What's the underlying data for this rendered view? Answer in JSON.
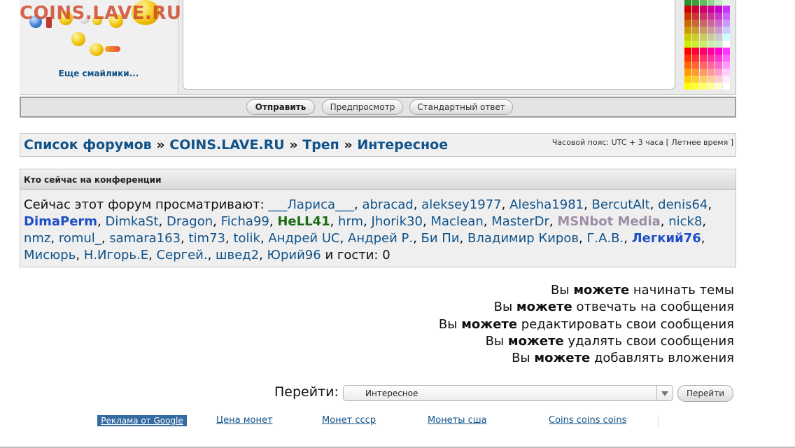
{
  "watermark": "COINS.LAVE.RU",
  "smileys": {
    "more_link": "Еще смайлики..."
  },
  "palette": {
    "colors": [
      [
        "#2e8b2e",
        "#3aa13a",
        "#5cbf5c",
        "#8fd68f",
        "#c2eec2",
        "#e6f9e6"
      ],
      [
        "#cc0000",
        "#cc0033",
        "#cc0066",
        "#cc0099",
        "#cc00cc",
        "#cc33ff"
      ],
      [
        "#cc3300",
        "#cc3333",
        "#cc3366",
        "#cc3399",
        "#cc33cc",
        "#cc66ff"
      ],
      [
        "#cc6600",
        "#cc6633",
        "#cc6666",
        "#cc6699",
        "#cc66cc",
        "#cc99ff"
      ],
      [
        "#cc9900",
        "#cc9933",
        "#cc9966",
        "#cc9999",
        "#cc99cc",
        "#ccccff"
      ],
      [
        "#cccc00",
        "#cccc33",
        "#cccc66",
        "#cccc99",
        "#cccccc",
        "#ccffff"
      ],
      [
        "#ccee00",
        "#ccee33",
        "#ccee66",
        "#cceeaa",
        "#cceecc",
        "#ffffff"
      ],
      [
        "#ff0000",
        "#ff0033",
        "#ff0066",
        "#ff0099",
        "#ff00cc",
        "#ff33ff"
      ],
      [
        "#ff3300",
        "#ff3333",
        "#ff3366",
        "#ff3399",
        "#ff33cc",
        "#ff66ff"
      ],
      [
        "#ff6600",
        "#ff6633",
        "#ff6666",
        "#ff6699",
        "#ff66cc",
        "#ff99ff"
      ],
      [
        "#ff9900",
        "#ff9933",
        "#ff9966",
        "#ff9999",
        "#ff99cc",
        "#ffccff"
      ],
      [
        "#ffcc00",
        "#ffcc33",
        "#ffcc66",
        "#ffcc99",
        "#ffcccc",
        "#ffeeff"
      ],
      [
        "#ffff00",
        "#ffff33",
        "#ffff66",
        "#ffff99",
        "#ffffcc",
        "#ffffff"
      ]
    ]
  },
  "buttons": {
    "submit": "Отправить",
    "preview": "Предпросмотр",
    "standard": "Стандартный ответ"
  },
  "breadcrumb": {
    "items": [
      "Список форумов",
      "COINS.LAVE.RU",
      "Треп",
      "Интересное"
    ],
    "separator": "»"
  },
  "timezone": "Часовой пояс: UTC + 3 часа [ Летнее время ]",
  "online": {
    "title": "Кто сейчас на конференции",
    "prefix": "Сейчас этот форум просматривают:",
    "users": [
      {
        "name": "___Лариса___",
        "type": "user"
      },
      {
        "name": "abracad",
        "type": "user"
      },
      {
        "name": "aleksey1977",
        "type": "user"
      },
      {
        "name": "Alesha1981",
        "type": "user"
      },
      {
        "name": "BercutAlt",
        "type": "user"
      },
      {
        "name": "denis64",
        "type": "user"
      },
      {
        "name": "DimaPerm",
        "type": "mod"
      },
      {
        "name": "DimkaSt",
        "type": "user"
      },
      {
        "name": "Dragon",
        "type": "user"
      },
      {
        "name": "Ficha99",
        "type": "user"
      },
      {
        "name": "HeLL41",
        "type": "adm"
      },
      {
        "name": "hrm",
        "type": "user"
      },
      {
        "name": "Jhorik30",
        "type": "user"
      },
      {
        "name": "MacIean",
        "type": "user"
      },
      {
        "name": "MasterDr",
        "type": "user"
      },
      {
        "name": "MSNbot Media",
        "type": "bot"
      },
      {
        "name": "nick8",
        "type": "user"
      },
      {
        "name": "nmz",
        "type": "user"
      },
      {
        "name": "romul_",
        "type": "user"
      },
      {
        "name": "samara163",
        "type": "user"
      },
      {
        "name": "tim73",
        "type": "user"
      },
      {
        "name": "tolik",
        "type": "user"
      },
      {
        "name": "Андрей UC",
        "type": "user"
      },
      {
        "name": "Андрей Р.",
        "type": "user"
      },
      {
        "name": "Би Пи",
        "type": "user"
      },
      {
        "name": "Владимир Киров",
        "type": "user"
      },
      {
        "name": "Г.А.В.",
        "type": "user"
      },
      {
        "name": "Легкий76",
        "type": "mod"
      },
      {
        "name": "Мисюрь",
        "type": "user"
      },
      {
        "name": "Н.Игорь.Е",
        "type": "user"
      },
      {
        "name": "Сергей.",
        "type": "user"
      },
      {
        "name": "швед2",
        "type": "user"
      },
      {
        "name": "Юрий96",
        "type": "user"
      }
    ],
    "suffix": "и гости: 0"
  },
  "permissions": {
    "you": "Вы",
    "can": "можете",
    "items": [
      "начинать темы",
      "отвечать на сообщения",
      "редактировать свои сообщения",
      "удалять свои сообщения",
      "добавлять вложения"
    ]
  },
  "jump": {
    "label": "Перейти:",
    "selected": "Интересное",
    "button": "Перейти"
  },
  "footer": {
    "ad_label": "Реклама от Google",
    "links": [
      "Цена монет",
      "Монет ссср",
      "Монеты сша",
      "Coins coins coins"
    ]
  }
}
